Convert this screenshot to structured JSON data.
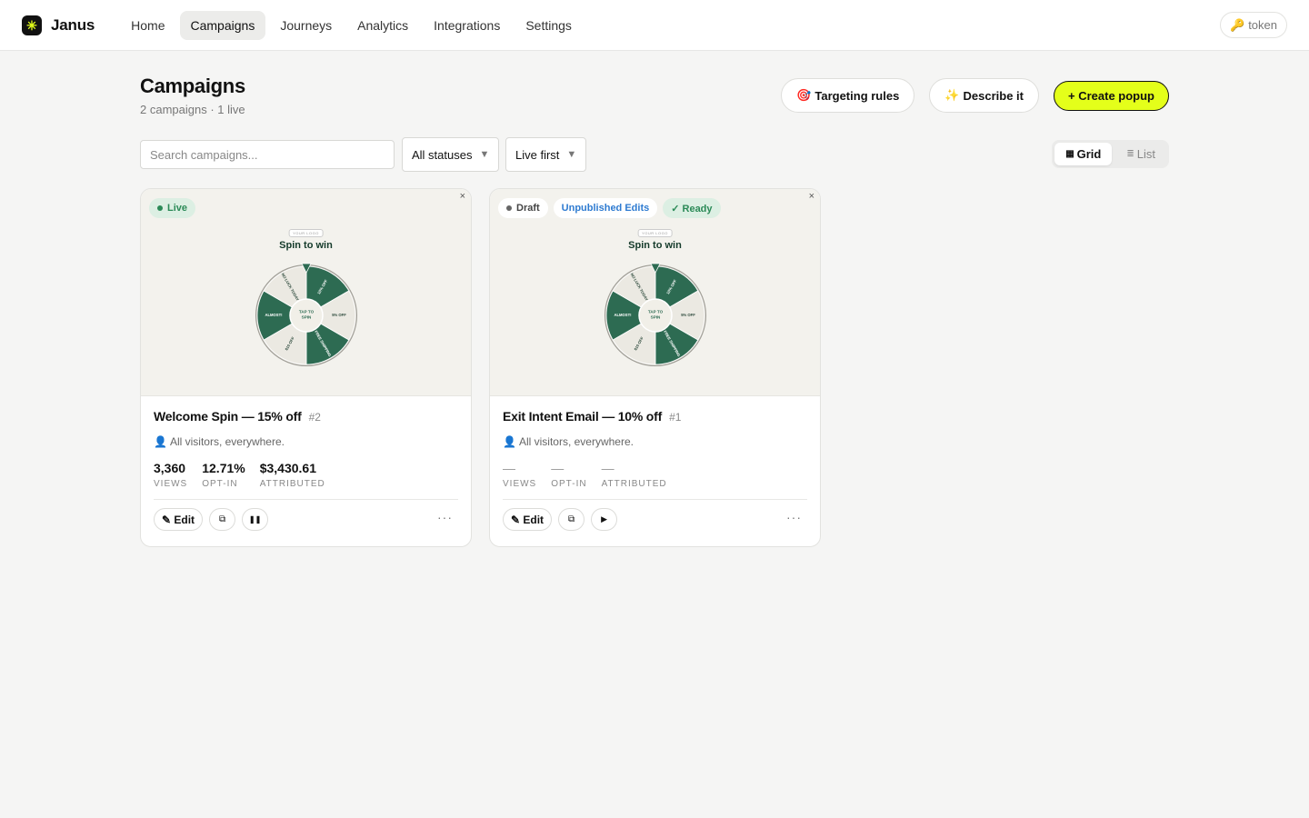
{
  "app": {
    "name": "Janus",
    "logo_glyph": "✳"
  },
  "nav": {
    "items": [
      {
        "label": "Home"
      },
      {
        "label": "Campaigns"
      },
      {
        "label": "Journeys"
      },
      {
        "label": "Analytics"
      },
      {
        "label": "Integrations"
      },
      {
        "label": "Settings"
      }
    ],
    "active": "Campaigns"
  },
  "token": {
    "icon": "key-icon",
    "glyph": "🔑",
    "label": "token"
  },
  "page": {
    "title": "Campaigns",
    "subtitle": "2 campaigns · 1 live"
  },
  "actions": {
    "targeting": {
      "glyph": "🎯",
      "label": "Targeting rules"
    },
    "describe": {
      "glyph": "✨",
      "label": "Describe it"
    },
    "create": {
      "label": "+ Create popup"
    }
  },
  "filters": {
    "search_placeholder": "Search campaigns...",
    "status": "All statuses",
    "sort": "Live first",
    "view": {
      "grid": "Grid",
      "list": "List",
      "active": "Grid"
    }
  },
  "preview": {
    "logo": "YOUR LOGO",
    "heading": "Spin to win"
  },
  "campaigns": [
    {
      "name": "Welcome Spin — 15% off",
      "number": "#2",
      "badges": [
        "Live"
      ],
      "audience": "All visitors, everywhere.",
      "metrics": {
        "views": "3,360",
        "optin": "12.71%",
        "attributed": "$3,430.61"
      },
      "metric_labels": {
        "views": "VIEWS",
        "optin": "OPT-IN",
        "attributed": "ATTRIBUTED"
      },
      "edit": "✎ Edit",
      "toggle_icon": "pause-icon",
      "toggle_glyph": "❚❚"
    },
    {
      "name": "Exit Intent Email — 10% off",
      "number": "#1",
      "badges": [
        "Draft",
        "Unpublished Edits",
        "✓ Ready"
      ],
      "audience": "All visitors, everywhere.",
      "metrics": {
        "views": "—",
        "optin": "—",
        "attributed": "—"
      },
      "metric_labels": {
        "views": "VIEWS",
        "optin": "OPT-IN",
        "attributed": "ATTRIBUTED"
      },
      "edit": "✎ Edit",
      "toggle_icon": "play-icon",
      "toggle_glyph": "▶"
    }
  ],
  "wheel": {
    "segments": [
      "10% OFF",
      "5% OFF",
      "FREE SHIPPING",
      "$10 OFF",
      "ALMOST!",
      "NO LUCK TODAY"
    ],
    "center": "TAP TO SPIN",
    "colors": {
      "dark": "#2d6b52",
      "light": "#ebe9e2"
    }
  },
  "colors": {
    "accent": "#e4ff1a",
    "live": "#2b8a57",
    "unpublished": "#2e7bd1"
  }
}
